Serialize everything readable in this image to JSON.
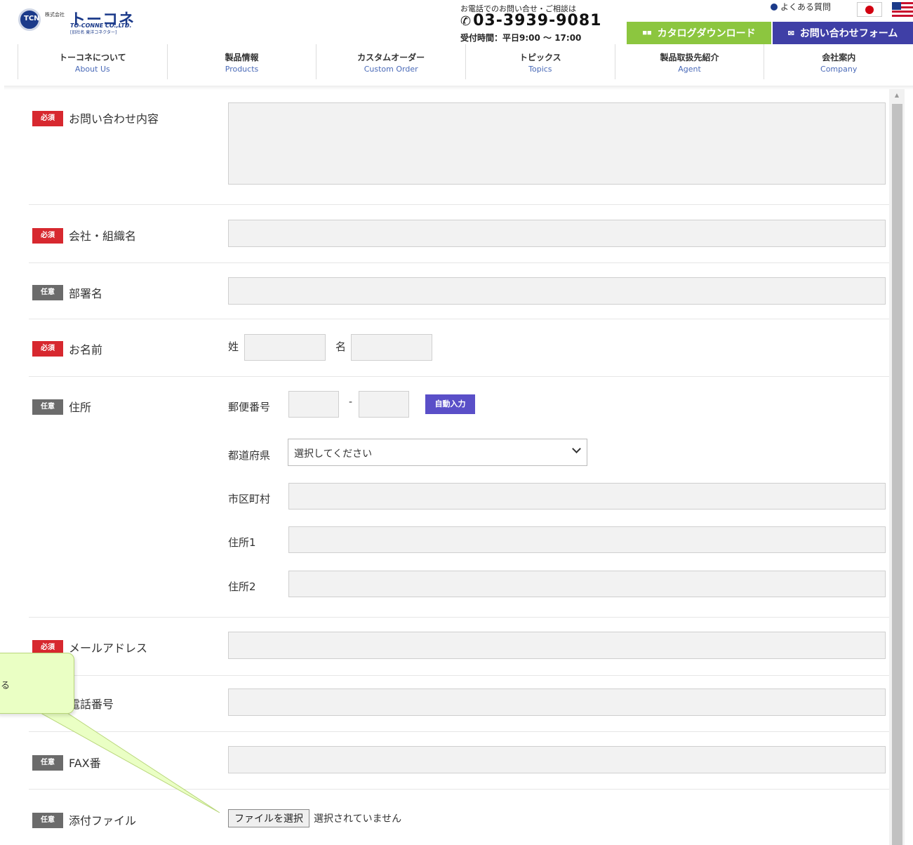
{
  "header": {
    "logo": {
      "mark": "TCN",
      "company_prefix": "株式会社",
      "name": "トーコネ",
      "name_en": "TO-CONNE CO.,LTD.",
      "former_name": "[旧社名 東洋コネクター]"
    },
    "phone": {
      "note": "お電話でのお問い合せ・ご相談は",
      "icon": "phone-icon",
      "number": "03-3939-9081",
      "hours": "受付時間：平日9:00 ～ 17:00"
    },
    "faq_label": "よくある質問",
    "catalog_button": "カタログダウンロード",
    "contact_button": "お問い合わせフォーム"
  },
  "nav": {
    "items": [
      {
        "jp": "トーコネについて",
        "en": "About Us"
      },
      {
        "jp": "製品情報",
        "en": "Products"
      },
      {
        "jp": "カスタムオーダー",
        "en": "Custom Order"
      },
      {
        "jp": "トピックス",
        "en": "Topics"
      },
      {
        "jp": "製品取扱先紹介",
        "en": "Agent"
      },
      {
        "jp": "会社案内",
        "en": "Company"
      }
    ]
  },
  "form": {
    "badges": {
      "required": "必須",
      "optional": "任意"
    },
    "inquiry_label": "お問い合わせ内容",
    "company_label": "会社・組織名",
    "department_label": "部署名",
    "name_label": "お名前",
    "last_name_label": "姓",
    "first_name_label": "名",
    "address_label": "住所",
    "postal_label": "郵便番号",
    "postal_dash": "-",
    "auto_fill_button": "自動入力",
    "prefecture_label": "都道府県",
    "prefecture_value": "選択してください",
    "city_label": "市区町村",
    "address1_label": "住所1",
    "address2_label": "住所2",
    "email_label": "メールアドレス",
    "phone_label": "電話番号",
    "fax_label": "FAX番",
    "attachment_label": "添付ファイル",
    "file_button": "ファイルを選択",
    "file_status": "選択されていません"
  },
  "callout": {
    "text": "る"
  },
  "colors": {
    "required": "#d7282f",
    "optional": "#6b6b6b",
    "catalog": "#8cc63f",
    "contact": "#3f3fa6",
    "auto_fill": "#5a4fc8",
    "callout_bg": "#eaffc4"
  }
}
